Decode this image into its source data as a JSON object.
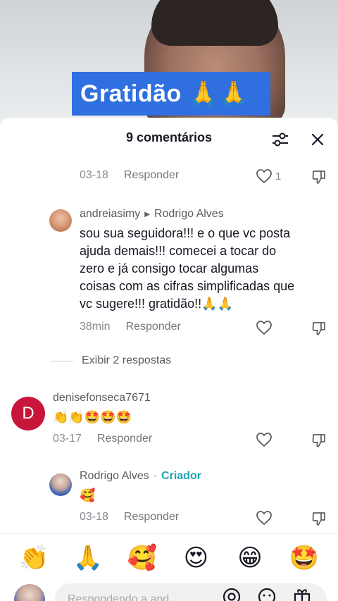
{
  "video": {
    "caption": "Gratidão 🙏🙏"
  },
  "header": {
    "title": "9 comentários",
    "filter_icon": "sliders-icon",
    "close_icon": "close-icon"
  },
  "comments": [
    {
      "time": "03-18",
      "reply_label": "Responder",
      "likes": "1"
    },
    {
      "author": "andreiasimy",
      "reply_to": "Rodrigo Alves",
      "text_lines": [
        "sou sua seguidora!!! e o que vc posta",
        "ajuda demais!!! comecei a tocar do",
        "zero e já consigo tocar algumas",
        "coisas com as cifras simplificadas que",
        "vc sugere!!! gratidão!!🙏🙏"
      ],
      "time": "38min",
      "reply_label": "Responder"
    },
    {
      "author": "denisefonseca7671",
      "avatar_letter": "D",
      "text": "👏👏🤩🤩🤩",
      "time": "03-17",
      "reply_label": "Responder"
    },
    {
      "author": "Rodrigo Alves",
      "creator_label": "Criador",
      "text": "🥰",
      "time": "03-18",
      "reply_label": "Responder"
    }
  ],
  "view_replies": "Exibir 2 respostas",
  "emoji_bar": [
    "👏",
    "🙏",
    "🥰",
    "😍",
    "😁",
    "🤩"
  ],
  "input": {
    "placeholder": "Respondendo a and..."
  },
  "colors": {
    "caption_bg": "#2f6fe0",
    "creator": "#1ea3b8",
    "denise_avatar": "#c8163a"
  }
}
